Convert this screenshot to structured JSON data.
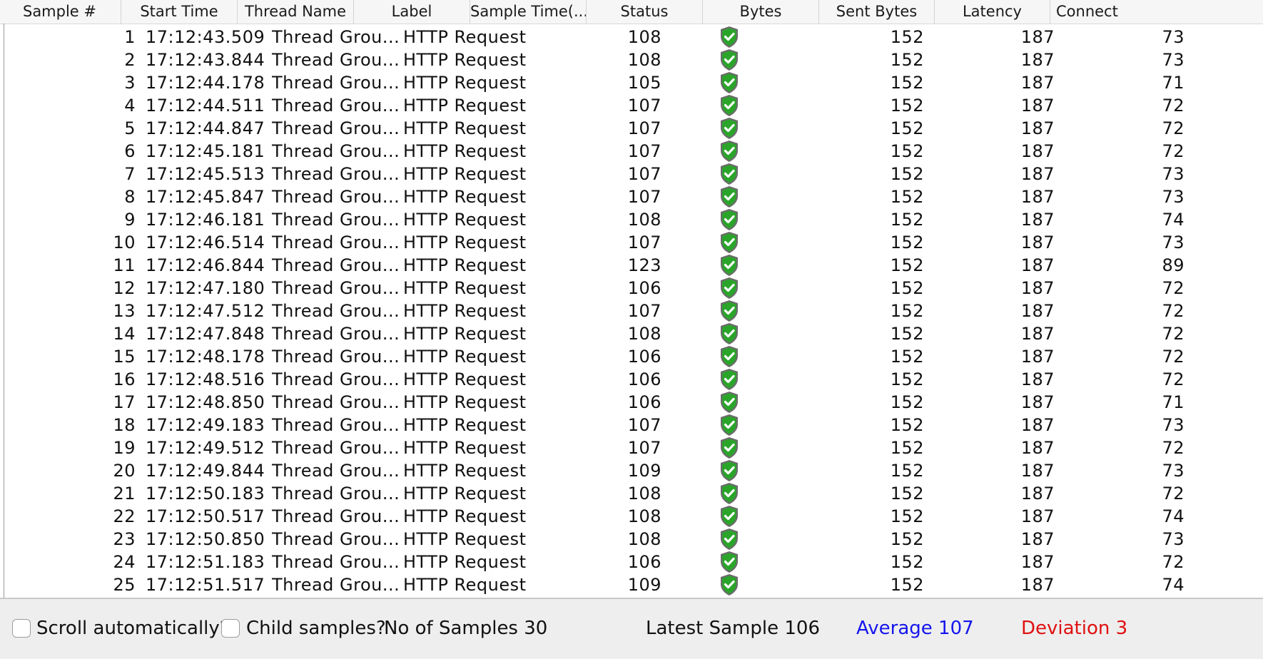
{
  "table": {
    "columns": [
      "Sample #",
      "Start Time",
      "Thread Name",
      "Label",
      "Sample Time(...",
      "Status",
      "Bytes",
      "Sent Bytes",
      "Latency",
      "Connect"
    ],
    "rows": [
      {
        "sample": "1",
        "start": "17:12:43.509",
        "thread": "Thread Grou...",
        "label": "HTTP Request",
        "time": "108",
        "bytes": "152",
        "sent": "187",
        "latency": "73"
      },
      {
        "sample": "2",
        "start": "17:12:43.844",
        "thread": "Thread Grou...",
        "label": "HTTP Request",
        "time": "108",
        "bytes": "152",
        "sent": "187",
        "latency": "73"
      },
      {
        "sample": "3",
        "start": "17:12:44.178",
        "thread": "Thread Grou...",
        "label": "HTTP Request",
        "time": "105",
        "bytes": "152",
        "sent": "187",
        "latency": "71"
      },
      {
        "sample": "4",
        "start": "17:12:44.511",
        "thread": "Thread Grou...",
        "label": "HTTP Request",
        "time": "107",
        "bytes": "152",
        "sent": "187",
        "latency": "72"
      },
      {
        "sample": "5",
        "start": "17:12:44.847",
        "thread": "Thread Grou...",
        "label": "HTTP Request",
        "time": "107",
        "bytes": "152",
        "sent": "187",
        "latency": "72"
      },
      {
        "sample": "6",
        "start": "17:12:45.181",
        "thread": "Thread Grou...",
        "label": "HTTP Request",
        "time": "107",
        "bytes": "152",
        "sent": "187",
        "latency": "72"
      },
      {
        "sample": "7",
        "start": "17:12:45.513",
        "thread": "Thread Grou...",
        "label": "HTTP Request",
        "time": "107",
        "bytes": "152",
        "sent": "187",
        "latency": "73"
      },
      {
        "sample": "8",
        "start": "17:12:45.847",
        "thread": "Thread Grou...",
        "label": "HTTP Request",
        "time": "107",
        "bytes": "152",
        "sent": "187",
        "latency": "73"
      },
      {
        "sample": "9",
        "start": "17:12:46.181",
        "thread": "Thread Grou...",
        "label": "HTTP Request",
        "time": "108",
        "bytes": "152",
        "sent": "187",
        "latency": "74"
      },
      {
        "sample": "10",
        "start": "17:12:46.514",
        "thread": "Thread Grou...",
        "label": "HTTP Request",
        "time": "107",
        "bytes": "152",
        "sent": "187",
        "latency": "73"
      },
      {
        "sample": "11",
        "start": "17:12:46.844",
        "thread": "Thread Grou...",
        "label": "HTTP Request",
        "time": "123",
        "bytes": "152",
        "sent": "187",
        "latency": "89"
      },
      {
        "sample": "12",
        "start": "17:12:47.180",
        "thread": "Thread Grou...",
        "label": "HTTP Request",
        "time": "106",
        "bytes": "152",
        "sent": "187",
        "latency": "72"
      },
      {
        "sample": "13",
        "start": "17:12:47.512",
        "thread": "Thread Grou...",
        "label": "HTTP Request",
        "time": "107",
        "bytes": "152",
        "sent": "187",
        "latency": "72"
      },
      {
        "sample": "14",
        "start": "17:12:47.848",
        "thread": "Thread Grou...",
        "label": "HTTP Request",
        "time": "108",
        "bytes": "152",
        "sent": "187",
        "latency": "72"
      },
      {
        "sample": "15",
        "start": "17:12:48.178",
        "thread": "Thread Grou...",
        "label": "HTTP Request",
        "time": "106",
        "bytes": "152",
        "sent": "187",
        "latency": "72"
      },
      {
        "sample": "16",
        "start": "17:12:48.516",
        "thread": "Thread Grou...",
        "label": "HTTP Request",
        "time": "106",
        "bytes": "152",
        "sent": "187",
        "latency": "72"
      },
      {
        "sample": "17",
        "start": "17:12:48.850",
        "thread": "Thread Grou...",
        "label": "HTTP Request",
        "time": "106",
        "bytes": "152",
        "sent": "187",
        "latency": "71"
      },
      {
        "sample": "18",
        "start": "17:12:49.183",
        "thread": "Thread Grou...",
        "label": "HTTP Request",
        "time": "107",
        "bytes": "152",
        "sent": "187",
        "latency": "73"
      },
      {
        "sample": "19",
        "start": "17:12:49.512",
        "thread": "Thread Grou...",
        "label": "HTTP Request",
        "time": "107",
        "bytes": "152",
        "sent": "187",
        "latency": "72"
      },
      {
        "sample": "20",
        "start": "17:12:49.844",
        "thread": "Thread Grou...",
        "label": "HTTP Request",
        "time": "109",
        "bytes": "152",
        "sent": "187",
        "latency": "73"
      },
      {
        "sample": "21",
        "start": "17:12:50.183",
        "thread": "Thread Grou...",
        "label": "HTTP Request",
        "time": "108",
        "bytes": "152",
        "sent": "187",
        "latency": "72"
      },
      {
        "sample": "22",
        "start": "17:12:50.517",
        "thread": "Thread Grou...",
        "label": "HTTP Request",
        "time": "108",
        "bytes": "152",
        "sent": "187",
        "latency": "74"
      },
      {
        "sample": "23",
        "start": "17:12:50.850",
        "thread": "Thread Grou...",
        "label": "HTTP Request",
        "time": "108",
        "bytes": "152",
        "sent": "187",
        "latency": "73"
      },
      {
        "sample": "24",
        "start": "17:12:51.183",
        "thread": "Thread Grou...",
        "label": "HTTP Request",
        "time": "106",
        "bytes": "152",
        "sent": "187",
        "latency": "72"
      },
      {
        "sample": "25",
        "start": "17:12:51.517",
        "thread": "Thread Grou...",
        "label": "HTTP Request",
        "time": "109",
        "bytes": "152",
        "sent": "187",
        "latency": "74"
      }
    ],
    "status_icon": "success-shield-icon",
    "status_color": "#2aa52a"
  },
  "footer": {
    "scroll_label": "Scroll automatically?",
    "child_label": "Child samples?",
    "samples_label": "No of Samples",
    "samples_value": "30",
    "latest_label": "Latest Sample",
    "latest_value": "106",
    "average_label": "Average",
    "average_value": "107",
    "average_color": "#1515ee",
    "deviation_label": "Deviation",
    "deviation_value": "3",
    "deviation_color": "#e01010"
  }
}
